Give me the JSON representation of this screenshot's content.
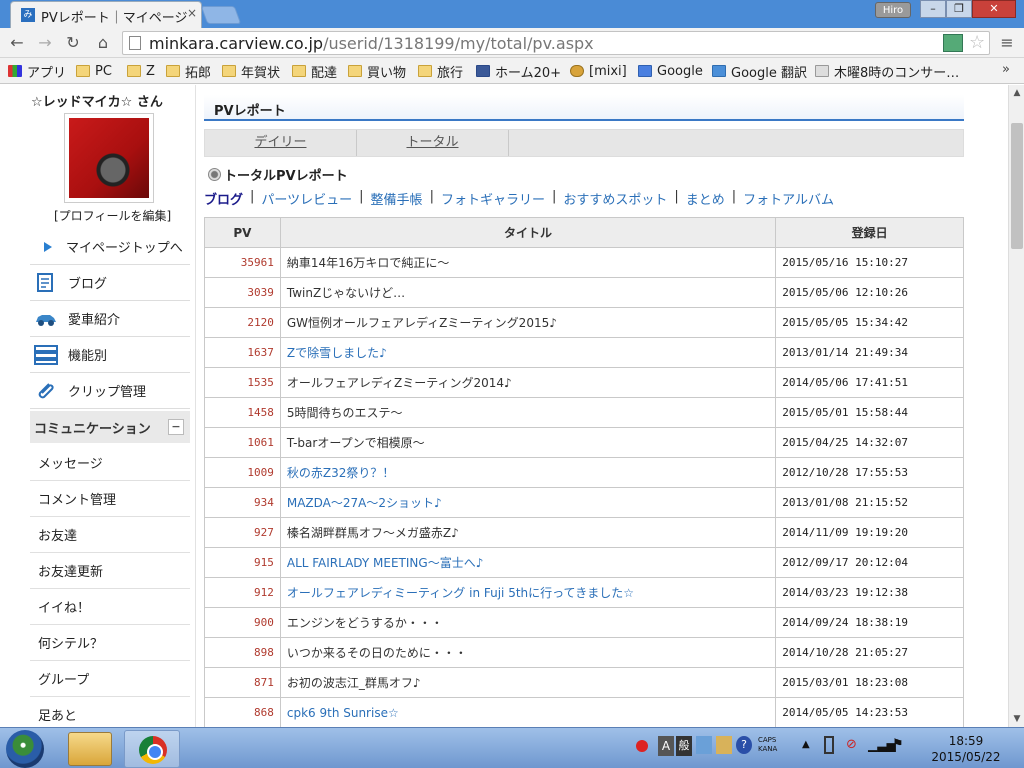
{
  "browser": {
    "tab_title": "PVレポート｜マイページ",
    "tab_close": "×",
    "profile_name": "Hiro",
    "win_min": "–",
    "win_max": "❐",
    "win_close": "✕",
    "url_host": "minkara.carview.co.jp",
    "url_path": "/userid/1318199/my/total/pv.aspx",
    "back": "←",
    "forward": "→",
    "reload": "↻",
    "home": "⌂",
    "star": "☆",
    "menu": "≡"
  },
  "bookmarks": [
    {
      "label": "アプリ",
      "icon": "apps-icon"
    },
    {
      "label": "PC",
      "icon": "folder-icon"
    },
    {
      "label": "Z",
      "icon": "folder-icon"
    },
    {
      "label": "拓郎",
      "icon": "folder-icon"
    },
    {
      "label": "年賀状",
      "icon": "folder-icon"
    },
    {
      "label": "配達",
      "icon": "folder-icon"
    },
    {
      "label": "買い物",
      "icon": "folder-icon"
    },
    {
      "label": "旅行",
      "icon": "folder-icon"
    },
    {
      "label": "ホーム20+",
      "icon": "facebook-icon"
    },
    {
      "label": "[mixi]",
      "icon": "mixi-icon"
    },
    {
      "label": "Google",
      "icon": "google-icon"
    },
    {
      "label": "Google 翻訳",
      "icon": "translate-icon"
    },
    {
      "label": "木曜8時のコンサー…",
      "icon": "keyword-icon"
    }
  ],
  "bookmarks_more": "»",
  "sidebar": {
    "username": "☆レッドマイカ☆ さん",
    "edit_profile": "[プロフィールを編集]",
    "top_link": "マイページトップへ",
    "items": [
      {
        "label": "ブログ",
        "icon": "blog-icon"
      },
      {
        "label": "愛車紹介",
        "icon": "car-icon"
      },
      {
        "label": "機能別",
        "icon": "list-icon"
      },
      {
        "label": "クリップ管理",
        "icon": "clip-icon"
      }
    ],
    "comm_header": "コミュニケーション",
    "comm_collapse": "−",
    "comm_items": [
      "メッセージ",
      "コメント管理",
      "お友達",
      "お友達更新",
      "イイね！",
      "何シテル？",
      "グループ",
      "足あと"
    ]
  },
  "main": {
    "title": "PVレポート",
    "tabs": [
      "デイリー",
      "トータル"
    ],
    "section_heading": "トータルPVレポート",
    "filters": [
      "ブログ",
      "パーツレビュー",
      "整備手帳",
      "フォトギャラリー",
      "おすすめスポット",
      "まとめ",
      "フォトアルバム"
    ],
    "columns": [
      "PV",
      "タイトル",
      "登録日"
    ],
    "rows": [
      {
        "pv": "35961",
        "title": "納車14年16万キロで純正に～",
        "date": "2015/05/16 15:10:27",
        "link": false
      },
      {
        "pv": "3039",
        "title": "TwinZじゃないけど…",
        "date": "2015/05/06 12:10:26",
        "link": false
      },
      {
        "pv": "2120",
        "title": "GW恒例オールフェアレディZミーティング2015♪",
        "date": "2015/05/05 15:34:42",
        "link": false
      },
      {
        "pv": "1637",
        "title": "Zで除雪しました♪",
        "date": "2013/01/14 21:49:34",
        "link": true
      },
      {
        "pv": "1535",
        "title": "オールフェアレディZミーティング2014♪",
        "date": "2014/05/06 17:41:51",
        "link": false
      },
      {
        "pv": "1458",
        "title": "5時間待ちのエステ～",
        "date": "2015/05/01 15:58:44",
        "link": false
      },
      {
        "pv": "1061",
        "title": "T-barオープンで相模原～",
        "date": "2015/04/25 14:32:07",
        "link": false
      },
      {
        "pv": "1009",
        "title": "秋の赤Z32祭り？！",
        "date": "2012/10/28 17:55:53",
        "link": true
      },
      {
        "pv": "934",
        "title": "MAZDA～27A～2ショット♪",
        "date": "2013/01/08 21:15:52",
        "link": true
      },
      {
        "pv": "927",
        "title": "榛名湖畔群馬オフ～メガ盛赤Z♪",
        "date": "2014/11/09 19:19:20",
        "link": false
      },
      {
        "pv": "915",
        "title": "ALL FAIRLADY MEETING～富士へ♪",
        "date": "2012/09/17 20:12:04",
        "link": true
      },
      {
        "pv": "912",
        "title": "オールフェアレディミーティング in Fuji 5thに行ってきました☆",
        "date": "2014/03/23 19:12:38",
        "link": true
      },
      {
        "pv": "900",
        "title": "エンジンをどうするか・・・",
        "date": "2014/09/24 18:38:19",
        "link": false
      },
      {
        "pv": "898",
        "title": "いつか来るその日のために・・・",
        "date": "2014/10/28 21:05:27",
        "link": false
      },
      {
        "pv": "871",
        "title": "お初の波志江_群馬オフ♪",
        "date": "2015/03/01 18:23:08",
        "link": false
      },
      {
        "pv": "868",
        "title": "cpk6 9th Sunrise☆",
        "date": "2014/05/05 14:23:53",
        "link": true
      }
    ]
  },
  "taskbar": {
    "ime_a": "A",
    "ime_kan": "般",
    "caps": "CAPS",
    "kana": "KANA",
    "clock_time": "18:59",
    "clock_date": "2015/05/22"
  },
  "colors": {
    "accent": "#3a78c5",
    "pv_red": "#b03a2e",
    "link_blue": "#2a6fb8"
  }
}
